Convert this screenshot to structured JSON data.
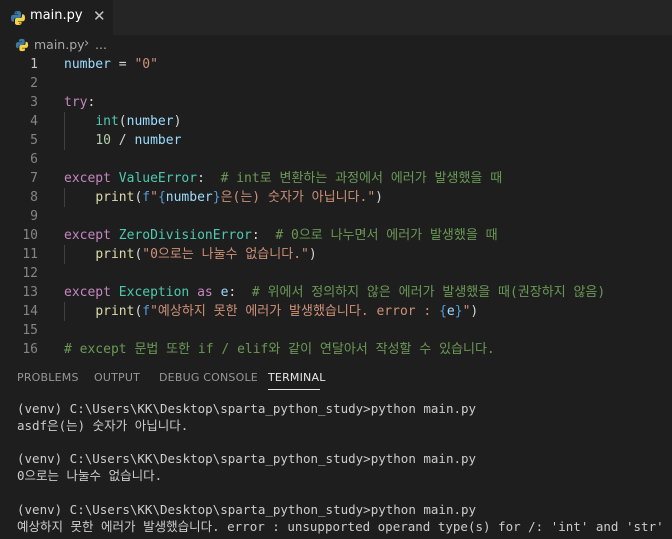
{
  "tab": {
    "label": "main.py",
    "close": "✕"
  },
  "breadcrumb": {
    "file": "main.py",
    "separator": "›",
    "more": "..."
  },
  "editor": {
    "active_line": 1,
    "lines": [
      {
        "n": "1",
        "tokens": [
          {
            "t": "number",
            "c": "var"
          },
          {
            "t": " = ",
            "c": "op"
          },
          {
            "t": "\"0\"",
            "c": "str"
          }
        ]
      },
      {
        "n": "2",
        "tokens": []
      },
      {
        "n": "3",
        "tokens": [
          {
            "t": "try",
            "c": "kw"
          },
          {
            "t": ":",
            "c": "op"
          }
        ]
      },
      {
        "n": "4",
        "indent": true,
        "tokens": [
          {
            "t": "    "
          },
          {
            "t": "int",
            "c": "type"
          },
          {
            "t": "(",
            "c": "op"
          },
          {
            "t": "number",
            "c": "var"
          },
          {
            "t": ")",
            "c": "op"
          }
        ]
      },
      {
        "n": "5",
        "indent": true,
        "tokens": [
          {
            "t": "    "
          },
          {
            "t": "10",
            "c": "num"
          },
          {
            "t": " / ",
            "c": "op"
          },
          {
            "t": "number",
            "c": "var"
          }
        ]
      },
      {
        "n": "6",
        "tokens": []
      },
      {
        "n": "7",
        "tokens": [
          {
            "t": "except",
            "c": "kw"
          },
          {
            "t": " "
          },
          {
            "t": "ValueError",
            "c": "type"
          },
          {
            "t": ":  ",
            "c": "op"
          },
          {
            "t": "# int로 변환하는 과정에서 에러가 발생했을 때",
            "c": "cmt"
          }
        ]
      },
      {
        "n": "8",
        "indent": true,
        "tokens": [
          {
            "t": "    "
          },
          {
            "t": "print",
            "c": "fn"
          },
          {
            "t": "(",
            "c": "op"
          },
          {
            "t": "f",
            "c": "kw2"
          },
          {
            "t": "\"",
            "c": "str"
          },
          {
            "t": "{",
            "c": "kw2"
          },
          {
            "t": "number",
            "c": "var"
          },
          {
            "t": "}",
            "c": "kw2"
          },
          {
            "t": "은(는) 숫자가 아닙니다.\"",
            "c": "str"
          },
          {
            "t": ")",
            "c": "op"
          }
        ]
      },
      {
        "n": "9",
        "tokens": []
      },
      {
        "n": "10",
        "tokens": [
          {
            "t": "except",
            "c": "kw"
          },
          {
            "t": " "
          },
          {
            "t": "ZeroDivisionError",
            "c": "type"
          },
          {
            "t": ":  ",
            "c": "op"
          },
          {
            "t": "# 0으로 나누면서 에러가 발생했을 때",
            "c": "cmt"
          }
        ]
      },
      {
        "n": "11",
        "indent": true,
        "tokens": [
          {
            "t": "    "
          },
          {
            "t": "print",
            "c": "fn"
          },
          {
            "t": "(",
            "c": "op"
          },
          {
            "t": "\"0으로는 나눌수 없습니다.\"",
            "c": "str"
          },
          {
            "t": ")",
            "c": "op"
          }
        ]
      },
      {
        "n": "12",
        "tokens": []
      },
      {
        "n": "13",
        "tokens": [
          {
            "t": "except",
            "c": "kw"
          },
          {
            "t": " "
          },
          {
            "t": "Exception",
            "c": "type"
          },
          {
            "t": " "
          },
          {
            "t": "as",
            "c": "kw"
          },
          {
            "t": " "
          },
          {
            "t": "e",
            "c": "var"
          },
          {
            "t": ":  ",
            "c": "op"
          },
          {
            "t": "# 위에서 정의하지 않은 에러가 발생했을 때(권장하지 않음)",
            "c": "cmt"
          }
        ]
      },
      {
        "n": "14",
        "indent": true,
        "tokens": [
          {
            "t": "    "
          },
          {
            "t": "print",
            "c": "fn"
          },
          {
            "t": "(",
            "c": "op"
          },
          {
            "t": "f",
            "c": "kw2"
          },
          {
            "t": "\"예상하지 못한 에러가 발생했습니다. error : ",
            "c": "str"
          },
          {
            "t": "{",
            "c": "kw2"
          },
          {
            "t": "e",
            "c": "var"
          },
          {
            "t": "}",
            "c": "kw2"
          },
          {
            "t": "\"",
            "c": "str"
          },
          {
            "t": ")",
            "c": "op"
          }
        ]
      },
      {
        "n": "15",
        "tokens": []
      },
      {
        "n": "16",
        "tokens": [
          {
            "t": "# except 문법 또한 if / elif와 같이 연달아서 작성할 수 있습니다.",
            "c": "cmt"
          }
        ]
      }
    ]
  },
  "colors": {
    "kw": "#c586c0",
    "kw2": "#569cd6",
    "type": "#4ec9b0",
    "fn": "#dcdcaa",
    "var": "#9cdcfe",
    "str": "#ce9178",
    "num": "#b5cea8",
    "cmt": "#6a9955",
    "op": "#d4d4d4"
  },
  "panel": {
    "tabs": [
      "PROBLEMS",
      "OUTPUT",
      "DEBUG CONSOLE",
      "TERMINAL"
    ],
    "active_tab": "TERMINAL"
  },
  "terminal": {
    "lines": [
      "(venv) C:\\Users\\KK\\Desktop\\sparta_python_study>python main.py",
      "asdf은(는) 숫자가 아닙니다.",
      "",
      "(venv) C:\\Users\\KK\\Desktop\\sparta_python_study>python main.py",
      "0으로는 나눌수 없습니다.",
      "",
      "(venv) C:\\Users\\KK\\Desktop\\sparta_python_study>python main.py",
      "예상하지 못한 에러가 발생했습니다. error : unsupported operand type(s) for /: 'int' and 'str'"
    ]
  }
}
